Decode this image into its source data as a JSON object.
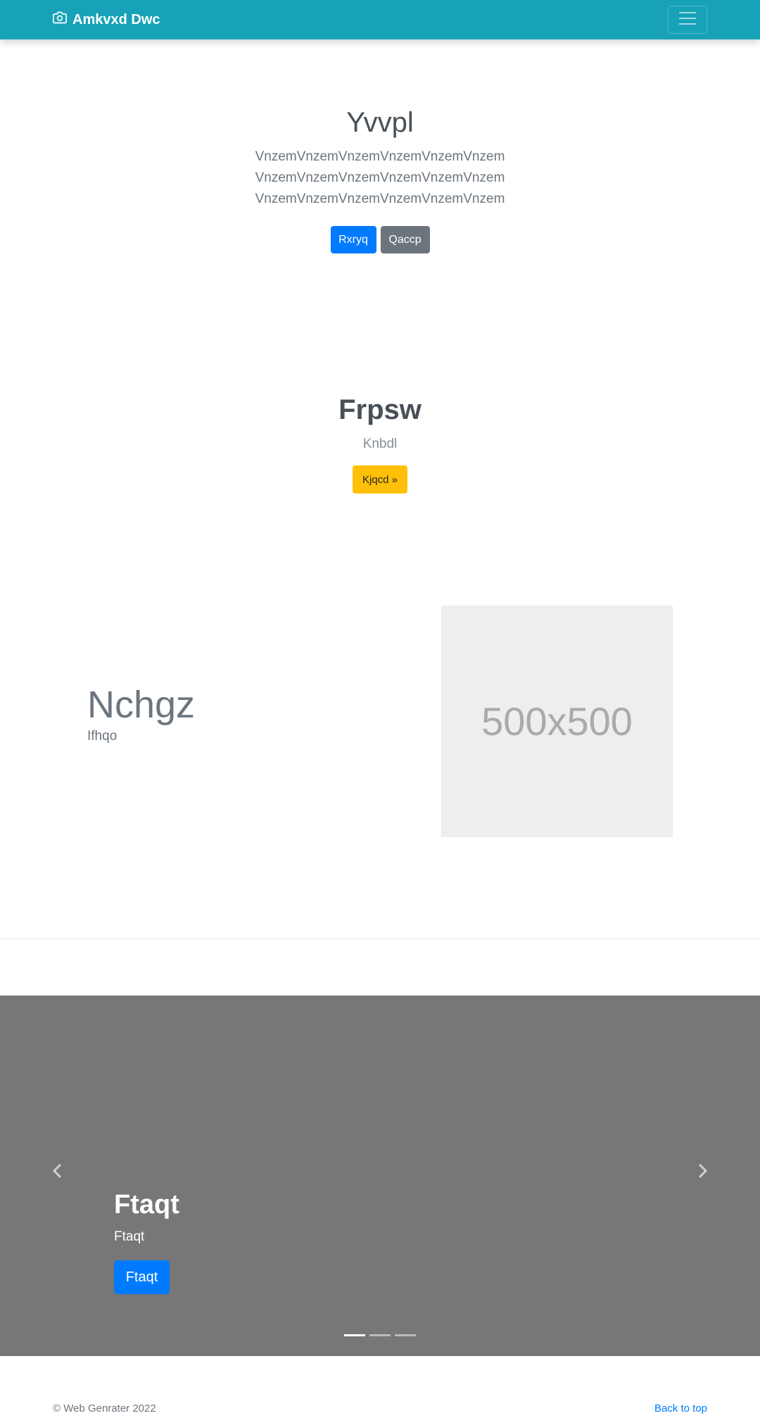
{
  "navbar": {
    "brand": "Amkvxd Dwc",
    "brand_icon": "camera-icon",
    "toggler_icon": "hamburger-menu-icon",
    "color": "#17a2b8"
  },
  "hero": {
    "title": "Yvvpl",
    "lead": "VnzemVnzemVnzemVnzemVnzemVnzemVnzemVnzemVnzemVnzemVnzemVnzemVnzemVnzemVnzemVnzemVnzemVnzem",
    "primary_button": "Rxryq",
    "secondary_button": "Qaccp"
  },
  "callout": {
    "title": "Frpsw",
    "subtitle": "Knbdl",
    "button": "Kjqcd »"
  },
  "feature": {
    "title": "Nchgz",
    "subtitle": "Ifhqo",
    "image_label": "500x500"
  },
  "carousel": {
    "slide_title": "Ftaqt",
    "slide_text": "Ftaqt",
    "slide_button": "Ftaqt",
    "prev_icon": "chevron-left-icon",
    "next_icon": "chevron-right-icon",
    "indicators": [
      {
        "active": true
      },
      {
        "active": false
      },
      {
        "active": false
      }
    ]
  },
  "footer": {
    "copyright": "© Web Genrater 2022",
    "back_to_top": "Back to top"
  }
}
